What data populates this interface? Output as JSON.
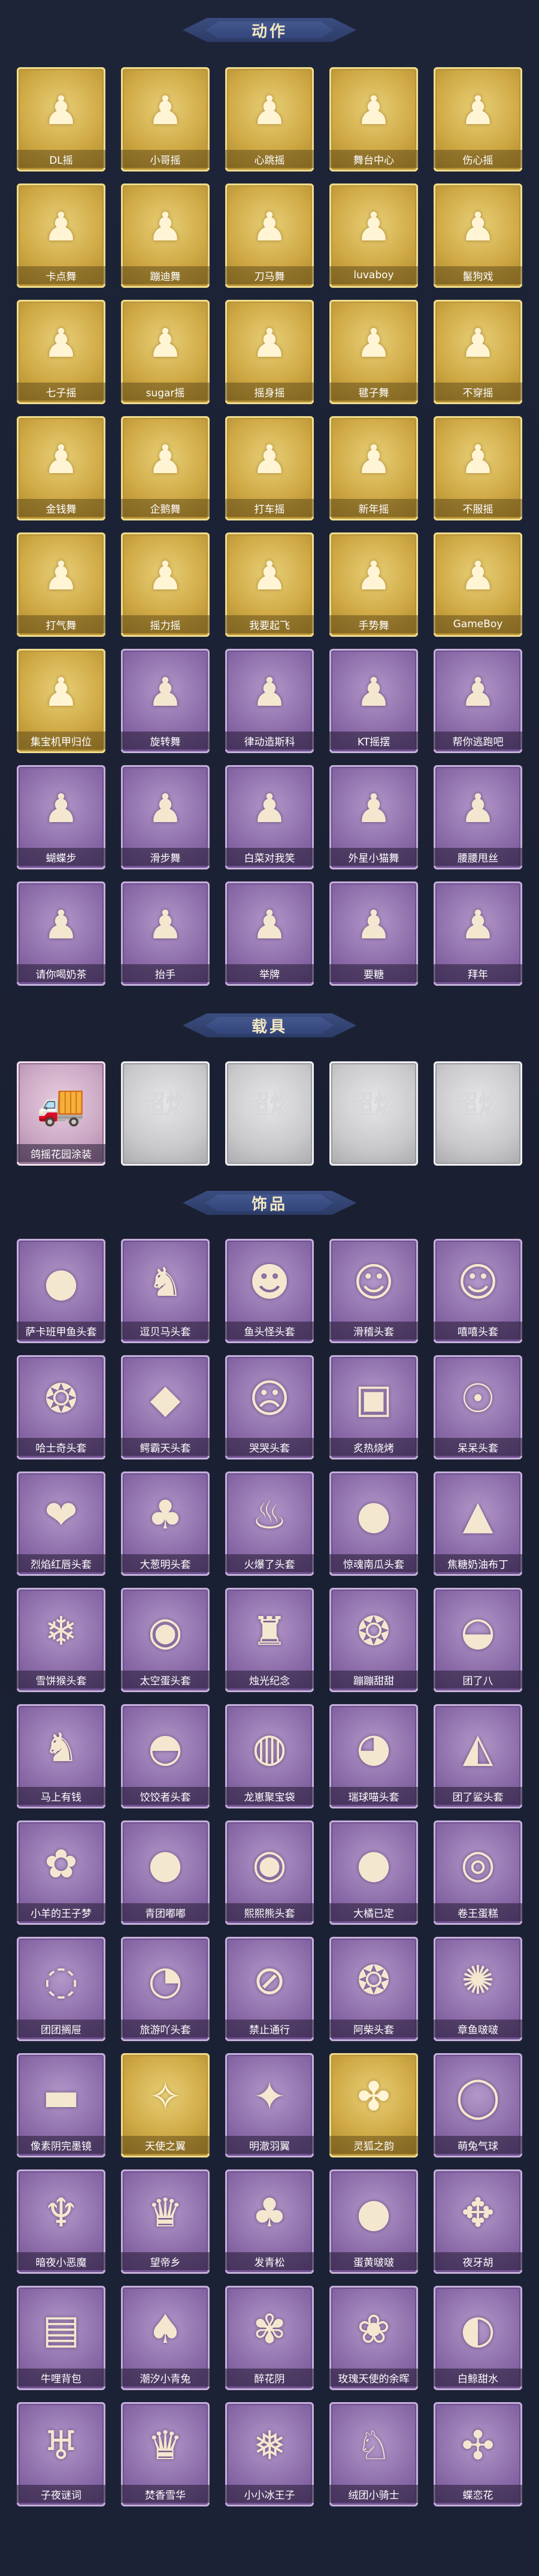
{
  "sections": [
    {
      "title": "动作",
      "rows": [
        [
          {
            "label": "DL摇",
            "variant": "gold",
            "icon": "dance-pose-icon"
          },
          {
            "label": "小哥摇",
            "variant": "gold",
            "icon": "dance-pose-icon"
          },
          {
            "label": "心跳摇",
            "variant": "gold",
            "icon": "dance-pose-icon"
          },
          {
            "label": "舞台中心",
            "variant": "gold",
            "icon": "dance-pose-icon"
          },
          {
            "label": "伤心摇",
            "variant": "gold",
            "icon": "dance-pose-icon"
          }
        ],
        [
          {
            "label": "卡点舞",
            "variant": "gold",
            "icon": "dance-pose-icon"
          },
          {
            "label": "蹦迪舞",
            "variant": "gold",
            "icon": "dance-pose-icon"
          },
          {
            "label": "刀马舞",
            "variant": "gold",
            "icon": "dance-pose-icon"
          },
          {
            "label": "luvaboy",
            "variant": "gold",
            "icon": "dance-pose-icon"
          },
          {
            "label": "鬣狗戏",
            "variant": "gold",
            "icon": "dance-pose-icon"
          }
        ],
        [
          {
            "label": "七子摇",
            "variant": "gold",
            "icon": "dance-pose-icon"
          },
          {
            "label": "sugar摇",
            "variant": "gold",
            "icon": "dance-pose-icon"
          },
          {
            "label": "摇身摇",
            "variant": "gold",
            "icon": "dance-pose-icon"
          },
          {
            "label": "毽子舞",
            "variant": "gold",
            "icon": "dance-pose-icon"
          },
          {
            "label": "不穿摇",
            "variant": "gold",
            "icon": "dance-pose-icon"
          }
        ],
        [
          {
            "label": "金钱舞",
            "variant": "gold",
            "icon": "dance-pose-icon"
          },
          {
            "label": "企鹅舞",
            "variant": "gold",
            "icon": "dance-pose-icon"
          },
          {
            "label": "打车摇",
            "variant": "gold",
            "icon": "dance-pose-icon"
          },
          {
            "label": "新年摇",
            "variant": "gold",
            "icon": "dance-pose-icon"
          },
          {
            "label": "不服摇",
            "variant": "gold",
            "icon": "dance-pose-icon"
          }
        ],
        [
          {
            "label": "打气舞",
            "variant": "gold",
            "icon": "dance-pose-icon"
          },
          {
            "label": "摇力摇",
            "variant": "gold",
            "icon": "dance-pose-icon"
          },
          {
            "label": "我要起飞",
            "variant": "gold",
            "icon": "dance-pose-icon"
          },
          {
            "label": "手势舞",
            "variant": "gold",
            "icon": "dance-pose-icon"
          },
          {
            "label": "GameBoy",
            "variant": "gold",
            "icon": "dance-pose-icon"
          }
        ],
        [
          {
            "label": "集宝机甲归位",
            "variant": "gold",
            "icon": "dance-pose-icon"
          },
          {
            "label": "旋转舞",
            "variant": "purple",
            "icon": "dance-pose-icon"
          },
          {
            "label": "律动造斯科",
            "variant": "purple",
            "icon": "dance-pose-icon"
          },
          {
            "label": "KT摇摆",
            "variant": "purple",
            "icon": "dance-pose-icon"
          },
          {
            "label": "帮你逃跑吧",
            "variant": "purple",
            "icon": "dance-pose-icon"
          }
        ],
        [
          {
            "label": "蝴蝶步",
            "variant": "purple",
            "icon": "dance-pose-icon"
          },
          {
            "label": "滑步舞",
            "variant": "purple",
            "icon": "dance-pose-icon"
          },
          {
            "label": "白菜对我笑",
            "variant": "purple",
            "icon": "dance-pose-icon"
          },
          {
            "label": "外星小猫舞",
            "variant": "purple",
            "icon": "dance-pose-icon"
          },
          {
            "label": "腰腰甩丝",
            "variant": "purple",
            "icon": "dance-pose-icon"
          }
        ],
        [
          {
            "label": "请你喝奶茶",
            "variant": "purple",
            "icon": "dance-pose-icon"
          },
          {
            "label": "抬手",
            "variant": "purple",
            "icon": "dance-pose-icon"
          },
          {
            "label": "举牌",
            "variant": "purple",
            "icon": "dance-pose-icon"
          },
          {
            "label": "要糖",
            "variant": "purple",
            "icon": "dance-pose-icon"
          },
          {
            "label": "拜年",
            "variant": "purple",
            "icon": "dance-pose-icon"
          }
        ]
      ]
    },
    {
      "title": "载具",
      "rows": [
        [
          {
            "label": "鸽摇花园涂装",
            "variant": "pink",
            "icon": "vehicle-icon"
          },
          {
            "label": "",
            "variant": "silver",
            "icon": "placeholder-logo-icon"
          },
          {
            "label": "",
            "variant": "silver",
            "icon": "placeholder-logo-icon"
          },
          {
            "label": "",
            "variant": "silver",
            "icon": "placeholder-logo-icon"
          },
          {
            "label": "",
            "variant": "silver",
            "icon": "placeholder-logo-icon"
          }
        ]
      ]
    },
    {
      "title": "饰品",
      "rows": [
        [
          {
            "label": "萨卡班甲鱼头套",
            "variant": "purple",
            "icon": "fish-head-icon"
          },
          {
            "label": "逗贝马头套",
            "variant": "purple",
            "icon": "horse-head-icon"
          },
          {
            "label": "鱼头怪头套",
            "variant": "purple",
            "icon": "fish-monster-head-icon"
          },
          {
            "label": "滑稽头套",
            "variant": "purple",
            "icon": "smile-face-icon"
          },
          {
            "label": "嘻嘻头套",
            "variant": "purple",
            "icon": "grin-face-icon"
          }
        ],
        [
          {
            "label": "哈士奇头套",
            "variant": "purple",
            "icon": "husky-head-icon"
          },
          {
            "label": "鳄霸天头套",
            "variant": "purple",
            "icon": "crocodile-head-icon"
          },
          {
            "label": "哭哭头套",
            "variant": "purple",
            "icon": "cry-face-icon"
          },
          {
            "label": "炙热烧烤",
            "variant": "purple",
            "icon": "grill-head-icon"
          },
          {
            "label": "呆呆头套",
            "variant": "purple",
            "icon": "dumb-face-icon"
          }
        ],
        [
          {
            "label": "烈焰红唇头套",
            "variant": "purple",
            "icon": "lips-head-icon"
          },
          {
            "label": "大葱明头套",
            "variant": "purple",
            "icon": "scallion-head-icon"
          },
          {
            "label": "火爆了头套",
            "variant": "purple",
            "icon": "fire-head-icon"
          },
          {
            "label": "惊魂南瓜头套",
            "variant": "purple",
            "icon": "pumpkin-head-icon"
          },
          {
            "label": "焦糖奶油布丁",
            "variant": "purple",
            "icon": "pudding-head-icon"
          }
        ],
        [
          {
            "label": "雪饼猴头套",
            "variant": "purple",
            "icon": "snow-monkey-icon"
          },
          {
            "label": "太空蛋头套",
            "variant": "purple",
            "icon": "space-egg-icon"
          },
          {
            "label": "烛光纪念",
            "variant": "purple",
            "icon": "candle-icon"
          },
          {
            "label": "蹦蹦甜甜",
            "variant": "purple",
            "icon": "dog-head-icon"
          },
          {
            "label": "团了八",
            "variant": "purple",
            "icon": "dumpling-head-icon"
          }
        ],
        [
          {
            "label": "马上有钱",
            "variant": "purple",
            "icon": "money-horse-icon"
          },
          {
            "label": "饺饺者头套",
            "variant": "purple",
            "icon": "dumpling-icon"
          },
          {
            "label": "龙崽聚宝袋",
            "variant": "purple",
            "icon": "dragon-bag-icon"
          },
          {
            "label": "瑞球喵头套",
            "variant": "purple",
            "icon": "cat-head-icon"
          },
          {
            "label": "团了鲨头套",
            "variant": "purple",
            "icon": "shark-head-icon"
          }
        ],
        [
          {
            "label": "小羊的王子梦",
            "variant": "purple",
            "icon": "sheep-head-icon"
          },
          {
            "label": "青团嘟嘟",
            "variant": "purple",
            "icon": "green-bun-icon"
          },
          {
            "label": "熙熙熊头套",
            "variant": "purple",
            "icon": "bear-head-icon"
          },
          {
            "label": "大橘已定",
            "variant": "purple",
            "icon": "orange-head-icon"
          },
          {
            "label": "卷王蛋糕",
            "variant": "purple",
            "icon": "cake-roll-icon"
          }
        ],
        [
          {
            "label": "团团搁屉",
            "variant": "purple",
            "icon": "steamer-head-icon"
          },
          {
            "label": "旅游吖头套",
            "variant": "purple",
            "icon": "travel-duck-icon"
          },
          {
            "label": "禁止通行",
            "variant": "purple",
            "icon": "no-entry-icon"
          },
          {
            "label": "阿柴头套",
            "variant": "purple",
            "icon": "shiba-head-icon"
          },
          {
            "label": "章鱼啵啵",
            "variant": "purple",
            "icon": "octopus-head-icon"
          }
        ],
        [
          {
            "label": "像素阴完墨镜",
            "variant": "purple",
            "icon": "pixel-glasses-icon"
          },
          {
            "label": "天使之翼",
            "variant": "gold",
            "icon": "angel-wings-icon"
          },
          {
            "label": "明澈羽翼",
            "variant": "purple",
            "icon": "wings-icon"
          },
          {
            "label": "灵狐之韵",
            "variant": "gold",
            "icon": "fox-tail-icon"
          },
          {
            "label": "萌兔气球",
            "variant": "purple",
            "icon": "bunny-balloon-icon"
          }
        ],
        [
          {
            "label": "暗夜小恶魔",
            "variant": "purple",
            "icon": "devil-icon"
          },
          {
            "label": "望帝乡",
            "variant": "purple",
            "icon": "doll-icon"
          },
          {
            "label": "发青松",
            "variant": "purple",
            "icon": "bonsai-icon"
          },
          {
            "label": "蛋黄啵啵",
            "variant": "purple",
            "icon": "yolk-icon"
          },
          {
            "label": "夜牙胡",
            "variant": "purple",
            "icon": "ghost-icon"
          }
        ],
        [
          {
            "label": "牛哩背包",
            "variant": "purple",
            "icon": "backpack-icon"
          },
          {
            "label": "潮汐小青兔",
            "variant": "purple",
            "icon": "bunny-icon"
          },
          {
            "label": "醉花阴",
            "variant": "purple",
            "icon": "flower-icon"
          },
          {
            "label": "玫瑰天使的余晖",
            "variant": "purple",
            "icon": "rose-doll-icon"
          },
          {
            "label": "白鲸甜水",
            "variant": "purple",
            "icon": "whale-icon"
          }
        ],
        [
          {
            "label": "子夜谜词",
            "variant": "purple",
            "icon": "crow-icon"
          },
          {
            "label": "焚香雪华",
            "variant": "purple",
            "icon": "doll-icon"
          },
          {
            "label": "小小冰王子",
            "variant": "purple",
            "icon": "ice-prince-icon"
          },
          {
            "label": "绒团小骑士",
            "variant": "purple",
            "icon": "knight-doll-icon"
          },
          {
            "label": "蝶恋花",
            "variant": "purple",
            "icon": "butterfly-icon"
          }
        ]
      ]
    }
  ],
  "silver_logo_text": "超燃",
  "colors": {
    "background": "#1c2234",
    "ribbon": "#33457a",
    "title_text": "#f3e8c2",
    "gold": "#cfa945",
    "purple": "#8a6aa7",
    "silver": "#c9c9cc"
  }
}
